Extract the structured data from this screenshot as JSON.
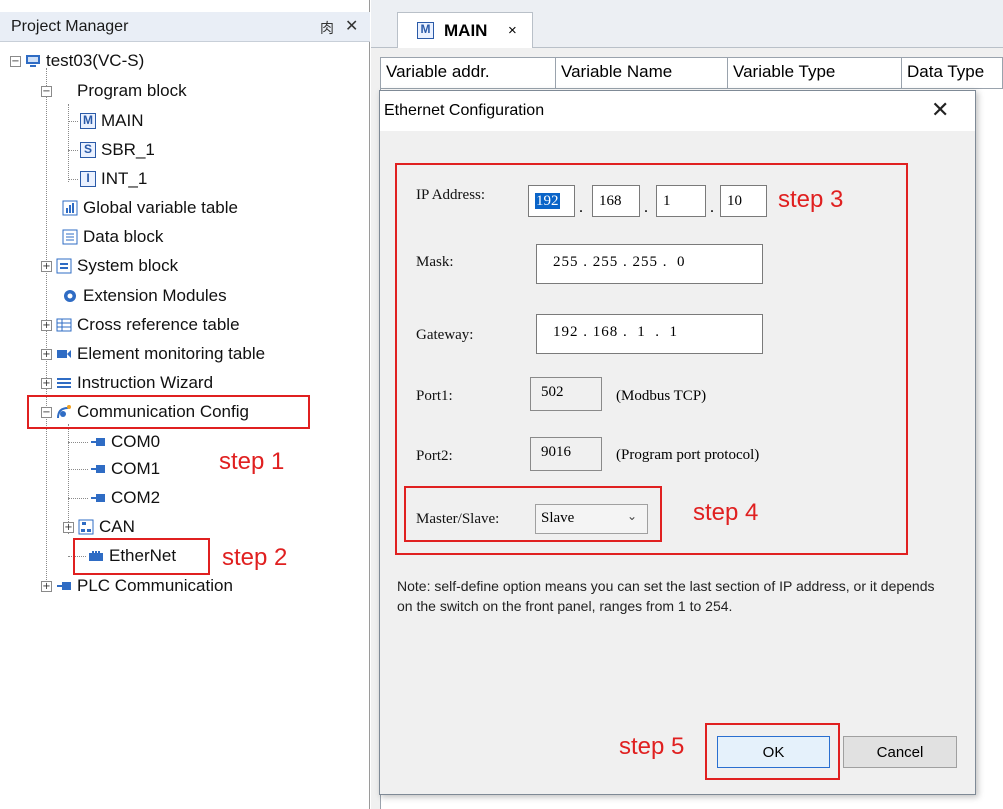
{
  "project_manager": {
    "title": "Project Manager",
    "pin_glyph": "⾁",
    "close_glyph": "✕",
    "tree": {
      "root": "test03(VC-S)",
      "program_block": "Program block",
      "main": "MAIN",
      "sbr": "SBR_1",
      "int": "INT_1",
      "global_var": "Global variable table",
      "data_block": "Data block",
      "system_block": "System block",
      "ext_modules": "Extension Modules",
      "cross_ref": "Cross reference table",
      "elem_mon": "Element monitoring table",
      "instr_wizard": "Instruction Wizard",
      "comm_config": "Communication Config",
      "com0": "COM0",
      "com1": "COM1",
      "com2": "COM2",
      "can": "CAN",
      "ethernet": "EtherNet",
      "plc_comm": "PLC Communication"
    }
  },
  "editor": {
    "tab_label": "MAIN",
    "tab_icon_letter": "M",
    "tab_close": "×",
    "columns": [
      "Variable addr.",
      "Variable Name",
      "Variable Type",
      "Data Type"
    ]
  },
  "dialog": {
    "title": "Ethernet Configuration",
    "close_glyph": "✕",
    "ip_label": "IP Address:",
    "ip": [
      "192",
      "168",
      "1",
      "10"
    ],
    "mask_label": "Mask:",
    "mask": "255 . 255 . 255 .  0",
    "gateway_label": "Gateway:",
    "gateway": "192 . 168 .  1  .  1",
    "port1_label": "Port1:",
    "port1": "502",
    "port1_hint": "(Modbus TCP)",
    "port2_label": "Port2:",
    "port2": "9016",
    "port2_hint": "(Program port protocol)",
    "ms_label": "Master/Slave:",
    "ms_value": "Slave",
    "note": "Note: self-define option means you can set the last section of IP address, or it depends on the switch on the front panel, ranges from 1 to 254.",
    "ok": "OK",
    "cancel": "Cancel"
  },
  "annotations": {
    "step1": "step 1",
    "step2": "step 2",
    "step3": "step 3",
    "step4": "step 4",
    "step5": "step 5",
    "color": "#e02020"
  },
  "colors": {
    "accent_blue": "#2f6cc4",
    "selection": "#0a64c8"
  }
}
